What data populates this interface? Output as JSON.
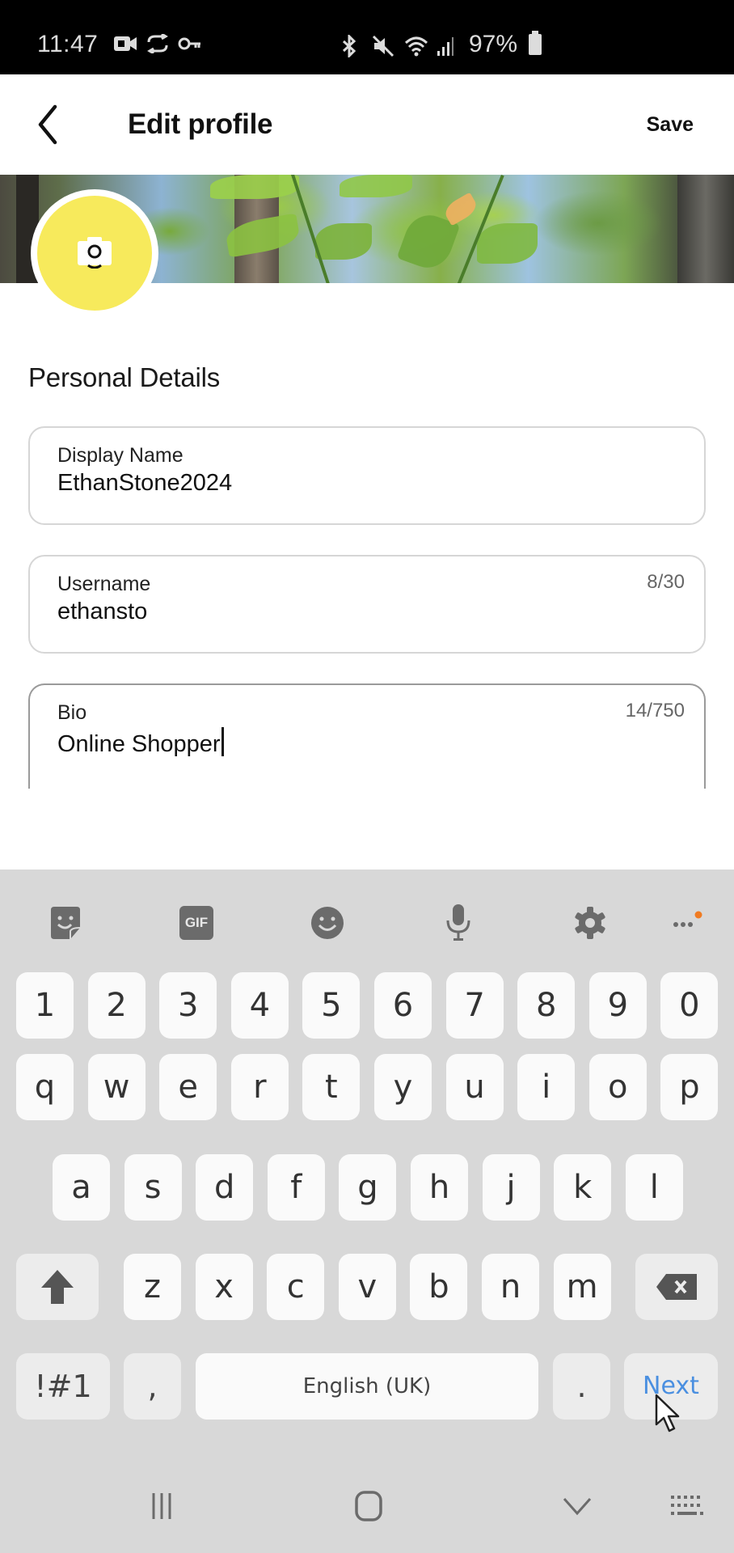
{
  "status_bar": {
    "time": "11:47",
    "left_icons": [
      "video-record-icon",
      "cloud-sync-icon",
      "vpn-key-icon"
    ],
    "right_icons": [
      "bluetooth-icon",
      "mute-icon",
      "wifi-icon",
      "signal-icon"
    ],
    "battery": "97%"
  },
  "app_bar": {
    "back_icon": "chevron-left-icon",
    "title": "Edit profile",
    "save_label": "Save"
  },
  "profile": {
    "avatar_color": "#f7ea5c",
    "avatar_icon": "camera-icon"
  },
  "section": {
    "title": "Personal Details"
  },
  "fields": {
    "display_name": {
      "label": "Display Name",
      "value": "EthanStone2024"
    },
    "username": {
      "label": "Username",
      "value": "ethansto",
      "counter": "8/30"
    },
    "bio": {
      "label": "Bio",
      "value": "Online Shopper",
      "counter": "14/750"
    }
  },
  "keyboard": {
    "toolbar": [
      "sticker-icon",
      "gif-icon",
      "emoji-icon",
      "microphone-icon",
      "settings-icon",
      "more-icon"
    ],
    "toolbar_gif_label": "GIF",
    "notification_dot_color": "#f07b22",
    "row_numbers": [
      "1",
      "2",
      "3",
      "4",
      "5",
      "6",
      "7",
      "8",
      "9",
      "0"
    ],
    "row1": [
      "q",
      "w",
      "e",
      "r",
      "t",
      "y",
      "u",
      "i",
      "o",
      "p"
    ],
    "row2": [
      "a",
      "s",
      "d",
      "f",
      "g",
      "h",
      "j",
      "k",
      "l"
    ],
    "row3": [
      "z",
      "x",
      "c",
      "v",
      "b",
      "n",
      "m"
    ],
    "symbols_label": "!#1",
    "comma_label": ",",
    "space_label": "English (UK)",
    "period_label": ".",
    "action_label": "Next",
    "action_color": "#4a8fe0"
  },
  "nav_bar": {
    "buttons": [
      "recents-icon",
      "home-icon",
      "hide-keyboard-icon",
      "keyboard-switch-icon"
    ]
  }
}
